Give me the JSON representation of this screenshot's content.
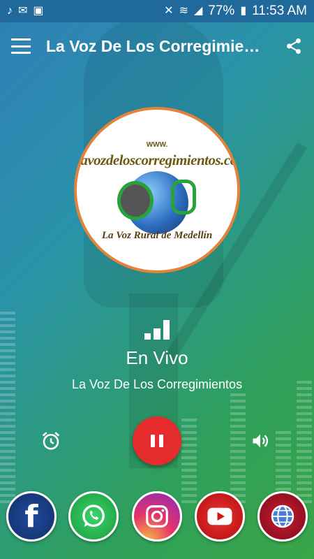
{
  "status_bar": {
    "left_icons": [
      "music-note-icon",
      "mail-icon",
      "image-icon"
    ],
    "right_icons": [
      "mute-icon",
      "wifi-icon",
      "signal-icon"
    ],
    "battery": "77%",
    "time": "11:53 AM"
  },
  "app_bar": {
    "title": "La Voz De Los Corregimientos"
  },
  "logo": {
    "small_text": "WWW.",
    "domain_text": "lavozdeloscorregimientos.com",
    "tagline": "La Voz Rural de Medellín"
  },
  "player": {
    "status": "En Vivo",
    "station": "La Voz De Los Corregimientos",
    "state": "playing"
  },
  "social": [
    {
      "name": "facebook"
    },
    {
      "name": "whatsapp"
    },
    {
      "name": "instagram"
    },
    {
      "name": "youtube"
    },
    {
      "name": "website"
    }
  ],
  "colors": {
    "accent": "#e52b2b",
    "logo_ring": "#e4823a"
  }
}
